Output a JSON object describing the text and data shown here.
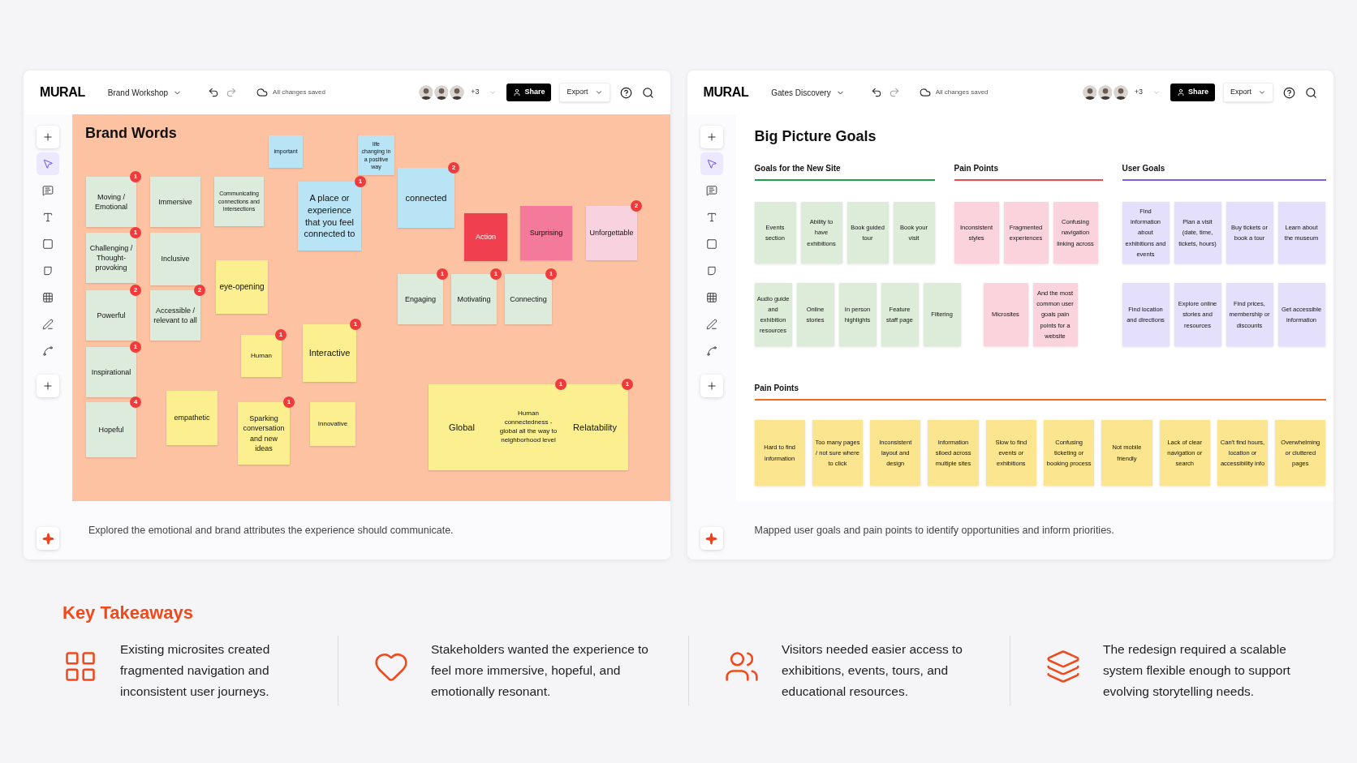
{
  "boards": [
    {
      "kind": "brand",
      "logo": "MURAL",
      "title": "Brand Workshop",
      "save_status": "All changes saved",
      "extra_collaborators": "+3",
      "share": "Share",
      "export": "Export",
      "tools": [
        {
          "kind": "add",
          "selected": false
        },
        {
          "kind": "select",
          "selected": true
        },
        {
          "kind": "comment",
          "selected": false
        },
        {
          "kind": "text",
          "selected": false
        },
        {
          "kind": "shape",
          "selected": false
        },
        {
          "kind": "note",
          "selected": false
        },
        {
          "kind": "table",
          "selected": false
        },
        {
          "kind": "pen",
          "selected": false
        },
        {
          "kind": "connector",
          "selected": false
        },
        {
          "kind": "add",
          "selected": false
        }
      ],
      "canvas": {
        "title": "Brand Words",
        "stickies": [
          {
            "text": "Moving / Emotional",
            "color": "#dcebdb",
            "badge": "1"
          },
          {
            "text": "Immersive",
            "color": "#dcebdb"
          },
          {
            "text": "Communicating connections and intersections",
            "color": "#dcebdb"
          },
          {
            "text": "important",
            "color": "#b9e4f6"
          },
          {
            "text": "life changing in a positive way",
            "color": "#b9e4f6"
          },
          {
            "text": "A place or experience that you feel connected to",
            "color": "#b9e4f6",
            "badge": "1"
          },
          {
            "text": "connected",
            "color": "#b9e4f6",
            "badge": "2"
          },
          {
            "text": "Action",
            "color": "#f0404f"
          },
          {
            "text": "Surprising",
            "color": "#f47a9b"
          },
          {
            "text": "Unforgettable",
            "color": "#f9d2e0",
            "badge": "2"
          },
          {
            "text": "Challenging / Thought-provoking",
            "color": "#dcebdb",
            "badge": "1"
          },
          {
            "text": "Inclusive",
            "color": "#dcebdb"
          },
          {
            "text": "eye-opening",
            "color": "#fcef8f"
          },
          {
            "text": "Engaging",
            "color": "#dcebdb",
            "badge": "1"
          },
          {
            "text": "Motivating",
            "color": "#dcebdb",
            "badge": "1"
          },
          {
            "text": "Connecting",
            "color": "#dcebdb",
            "badge": "1"
          },
          {
            "text": "Powerful",
            "color": "#dcebdb",
            "badge": "2"
          },
          {
            "text": "Accessible / relevant to all",
            "color": "#dcebdb",
            "badge": "2"
          },
          {
            "text": "Human",
            "color": "#fcef8f",
            "badge": "1"
          },
          {
            "text": "Interactive",
            "color": "#fcef8f",
            "badge": "1"
          },
          {
            "text": "Inspirational",
            "color": "#dcebdb",
            "badge": "1"
          },
          {
            "text": "Hopeful",
            "color": "#dcebdb",
            "badge": "4"
          },
          {
            "text": "empathetic",
            "color": "#fcef8f"
          },
          {
            "text": "Sparking conversation and new ideas",
            "color": "#fcef8f",
            "badge": "1"
          },
          {
            "text": "Innovative",
            "color": "#fcef8f"
          },
          {
            "color": "#fcef8f",
            "segments": [
              {
                "text": "Global"
              },
              {
                "text": "Human connectedness - global all the way to neighborhood level",
                "badge": "1"
              },
              {
                "text": "Relatability",
                "badge": "1"
              }
            ]
          }
        ]
      },
      "caption": "Explored the emotional and brand attributes the experience should communicate."
    },
    {
      "kind": "goals",
      "logo": "MURAL",
      "title": "Gates Discovery",
      "save_status": "All changes saved",
      "extra_collaborators": "+3",
      "share": "Share",
      "export": "Export",
      "tools": [
        {
          "kind": "add",
          "selected": false
        },
        {
          "kind": "select",
          "selected": true
        },
        {
          "kind": "comment",
          "selected": false
        },
        {
          "kind": "text",
          "selected": false
        },
        {
          "kind": "shape",
          "selected": false
        },
        {
          "kind": "note",
          "selected": false
        },
        {
          "kind": "table",
          "selected": false
        },
        {
          "kind": "pen",
          "selected": false
        },
        {
          "kind": "connector",
          "selected": false
        },
        {
          "kind": "add",
          "selected": false
        }
      ],
      "heading": "Big Picture Goals",
      "groups": [
        {
          "title": "Goals for the New Site",
          "color": "#1f9e4a",
          "rows": [
            [
              {
                "text": "Events section",
                "color": "#dcecd9"
              },
              {
                "text": "Ability to have exhibitions",
                "color": "#dcecd9"
              },
              {
                "text": "Book guided tour",
                "color": "#dcecd9"
              },
              {
                "text": "Book your visit",
                "color": "#dcecd9"
              }
            ],
            [
              {
                "text": "Audio guide and exhibition resources",
                "color": "#dcecd9"
              },
              {
                "text": "Online stories",
                "color": "#dcecd9"
              },
              {
                "text": "In person highlights",
                "color": "#dcecd9"
              },
              {
                "text": "Feature staff page",
                "color": "#dcecd9"
              },
              {
                "text": "Filtering",
                "color": "#dcecd9"
              }
            ]
          ]
        },
        {
          "title": "Pain Points",
          "color": "#ef4a4a",
          "rows": [
            [
              {
                "text": "Inconsistent styles",
                "color": "#fbd3dc"
              },
              {
                "text": "Fragmented experiences",
                "color": "#fbd3dc"
              },
              {
                "text": "Confusing navigation linking across",
                "color": "#fbd3dc"
              }
            ],
            [
              {
                "text": "Microsites",
                "color": "#fbd3dc"
              },
              {
                "text": "And the most common user goals pain points for a website",
                "color": "#fbd3dc"
              }
            ]
          ]
        },
        {
          "title": "User Goals",
          "color": "#7b5cf5",
          "rows": [
            [
              {
                "text": "Find information about exhibitions and events",
                "color": "#e4e0fb"
              },
              {
                "text": "Plan a visit (date, time, tickets, hours)",
                "color": "#e4e0fb"
              },
              {
                "text": "Buy tickets or book a tour",
                "color": "#e4e0fb"
              },
              {
                "text": "Learn about the museum",
                "color": "#e4e0fb"
              }
            ],
            [
              {
                "text": "Find location and directions",
                "color": "#e4e0fb"
              },
              {
                "text": "Explore online stories and resources",
                "color": "#e4e0fb"
              },
              {
                "text": "Find prices, membership or discounts",
                "color": "#e4e0fb"
              },
              {
                "text": "Get accessible information",
                "color": "#e4e0fb"
              }
            ]
          ]
        }
      ],
      "pain_section": {
        "title": "Pain Points",
        "color": "#f26a1b",
        "stickies": [
          {
            "text": "Hard to find information",
            "color": "#fbe58f"
          },
          {
            "text": "Too many pages / not sure where to click",
            "color": "#fbe58f"
          },
          {
            "text": "Inconsistent layout and design",
            "color": "#fbe58f"
          },
          {
            "text": "Information siloed across multiple sites",
            "color": "#fbe58f"
          },
          {
            "text": "Slow to find events or exhibitions",
            "color": "#fbe58f"
          },
          {
            "text": "Confusing ticketing or booking process",
            "color": "#fbe58f"
          },
          {
            "text": "Not mobile friendly",
            "color": "#fbe58f"
          },
          {
            "text": "Lack of clear navigation or search",
            "color": "#fbe58f"
          },
          {
            "text": "Can't find hours, location or accessibility info",
            "color": "#fbe58f"
          },
          {
            "text": "Overwhelming or cluttered pages",
            "color": "#fbe58f"
          }
        ]
      },
      "caption": "Mapped user goals and pain points to identify opportunities and inform priorities."
    }
  ],
  "takeaways": {
    "title": "Key Takeaways",
    "items": [
      {
        "kind": "grid",
        "text": "Existing microsites created fragmented navigation and inconsistent user journeys."
      },
      {
        "kind": "heart",
        "text": "Stakeholders wanted the experience to feel more immersive, hopeful, and emotionally resonant."
      },
      {
        "kind": "users",
        "text": "Visitors needed easier access to exhibitions, events, tours, and educational resources."
      },
      {
        "kind": "layers",
        "text": "The redesign required a scalable system flexible enough to support evolving storytelling needs."
      }
    ]
  }
}
